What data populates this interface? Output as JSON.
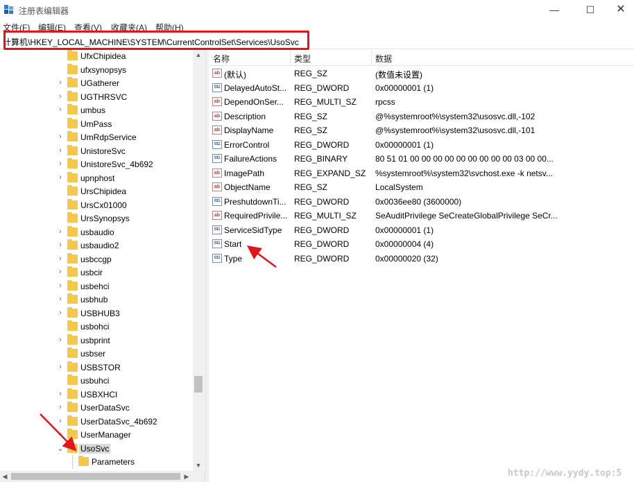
{
  "window": {
    "title": "注册表编辑器",
    "controls": {
      "minimize": "—",
      "maximize": "☐",
      "close": "✕"
    }
  },
  "menu": [
    "文件(F)",
    "编辑(E)",
    "查看(V)",
    "收藏夹(A)",
    "帮助(H)"
  ],
  "address": {
    "path": "计算机\\HKEY_LOCAL_MACHINE\\SYSTEM\\CurrentControlSet\\Services\\UsoSvc",
    "highlight_color": "#e3141c"
  },
  "tree": {
    "items": [
      {
        "label": "UfxChipidea",
        "expandable": false
      },
      {
        "label": "ufxsynopsys",
        "expandable": false
      },
      {
        "label": "UGatherer",
        "expandable": true
      },
      {
        "label": "UGTHRSVC",
        "expandable": true
      },
      {
        "label": "umbus",
        "expandable": true
      },
      {
        "label": "UmPass",
        "expandable": false
      },
      {
        "label": "UmRdpService",
        "expandable": true
      },
      {
        "label": "UnistoreSvc",
        "expandable": true
      },
      {
        "label": "UnistoreSvc_4b692",
        "expandable": true
      },
      {
        "label": "upnphost",
        "expandable": true
      },
      {
        "label": "UrsChipidea",
        "expandable": false
      },
      {
        "label": "UrsCx01000",
        "expandable": false
      },
      {
        "label": "UrsSynopsys",
        "expandable": false
      },
      {
        "label": "usbaudio",
        "expandable": true
      },
      {
        "label": "usbaudio2",
        "expandable": true
      },
      {
        "label": "usbccgp",
        "expandable": true
      },
      {
        "label": "usbcir",
        "expandable": true
      },
      {
        "label": "usbehci",
        "expandable": true
      },
      {
        "label": "usbhub",
        "expandable": true
      },
      {
        "label": "USBHUB3",
        "expandable": true
      },
      {
        "label": "usbohci",
        "expandable": false
      },
      {
        "label": "usbprint",
        "expandable": true
      },
      {
        "label": "usbser",
        "expandable": false
      },
      {
        "label": "USBSTOR",
        "expandable": true
      },
      {
        "label": "usbuhci",
        "expandable": false
      },
      {
        "label": "USBXHCI",
        "expandable": true
      },
      {
        "label": "UserDataSvc",
        "expandable": true
      },
      {
        "label": "UserDataSvc_4b692",
        "expandable": true
      },
      {
        "label": "UserManager",
        "expandable": true
      },
      {
        "label": "UsoSvc",
        "expandable": true,
        "expanded": true,
        "selected": true
      },
      {
        "label": "Parameters",
        "expandable": false,
        "child": true
      }
    ]
  },
  "values": {
    "headers": {
      "name": "名称",
      "type": "类型",
      "data": "数据"
    },
    "rows": [
      {
        "icon": "ab-string-icon",
        "name": "(默认)",
        "type": "REG_SZ",
        "data": "(数值未设置)"
      },
      {
        "icon": "binary-value-icon",
        "name": "DelayedAutoSt...",
        "type": "REG_DWORD",
        "data": "0x00000001 (1)"
      },
      {
        "icon": "ab-string-icon",
        "name": "DependOnSer...",
        "type": "REG_MULTI_SZ",
        "data": "rpcss"
      },
      {
        "icon": "ab-string-icon",
        "name": "Description",
        "type": "REG_SZ",
        "data": "@%systemroot%\\system32\\usosvc.dll,-102"
      },
      {
        "icon": "ab-string-icon",
        "name": "DisplayName",
        "type": "REG_SZ",
        "data": "@%systemroot%\\system32\\usosvc.dll,-101"
      },
      {
        "icon": "binary-value-icon",
        "name": "ErrorControl",
        "type": "REG_DWORD",
        "data": "0x00000001 (1)"
      },
      {
        "icon": "binary-value-icon",
        "name": "FailureActions",
        "type": "REG_BINARY",
        "data": "80 51 01 00 00 00 00 00 00 00 00 00 03 00 00..."
      },
      {
        "icon": "ab-string-icon",
        "name": "ImagePath",
        "type": "REG_EXPAND_SZ",
        "data": "%systemroot%\\system32\\svchost.exe -k netsv..."
      },
      {
        "icon": "ab-string-icon",
        "name": "ObjectName",
        "type": "REG_SZ",
        "data": "LocalSystem"
      },
      {
        "icon": "binary-value-icon",
        "name": "PreshutdownTi...",
        "type": "REG_DWORD",
        "data": "0x0036ee80 (3600000)"
      },
      {
        "icon": "ab-string-icon",
        "name": "RequiredPrivile...",
        "type": "REG_MULTI_SZ",
        "data": "SeAuditPrivilege SeCreateGlobalPrivilege SeCr..."
      },
      {
        "icon": "binary-value-icon",
        "name": "ServiceSidType",
        "type": "REG_DWORD",
        "data": "0x00000001 (1)"
      },
      {
        "icon": "binary-value-icon",
        "name": "Start",
        "type": "REG_DWORD",
        "data": "0x00000004 (4)"
      },
      {
        "icon": "binary-value-icon",
        "name": "Type",
        "type": "REG_DWORD",
        "data": "0x00000020 (32)"
      }
    ]
  },
  "watermark": "http://www.yydy.top:5",
  "annotation_color": "#e3141c"
}
